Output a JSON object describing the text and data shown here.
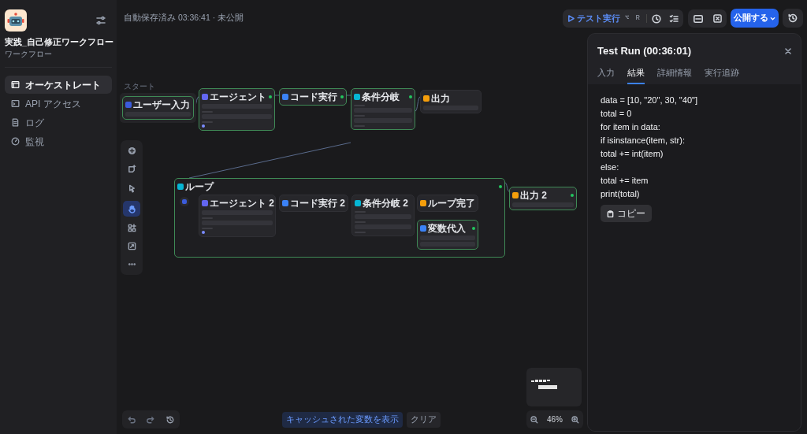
{
  "sidebar": {
    "app_title": "実践_自己修正ワークフロー",
    "app_type": "ワークフロー",
    "items": [
      {
        "kind": "orchestrate",
        "label": "オーケストレート",
        "selected": true
      },
      {
        "kind": "api",
        "label": "API アクセス",
        "selected": false
      },
      {
        "kind": "logs",
        "label": "ログ",
        "selected": false
      },
      {
        "kind": "monitor",
        "label": "監視",
        "selected": false
      }
    ]
  },
  "header": {
    "save_status": "自動保存済み 03:36:41 · 未公開",
    "test_run": "テスト実行",
    "shortcut_keys": [
      "⌥",
      "R"
    ],
    "publish": "公開する"
  },
  "canvas": {
    "start_group_label": "スタート",
    "nodes": [
      {
        "kind": "start",
        "title": "ユーザー入力",
        "succeeded": true
      },
      {
        "kind": "agent",
        "title": "エージェント",
        "succeeded": true
      },
      {
        "kind": "code",
        "title": "コード実行",
        "succeeded": true
      },
      {
        "kind": "ifelse",
        "title": "条件分岐",
        "succeeded": true
      },
      {
        "kind": "output",
        "title": "出力",
        "succeeded": false
      },
      {
        "kind": "loop",
        "title": "ループ",
        "succeeded": true,
        "children": [
          {
            "kind": "loop_start"
          },
          {
            "kind": "agent",
            "title": "エージェント 2",
            "succeeded": false
          },
          {
            "kind": "code",
            "title": "コード実行 2",
            "succeeded": false
          },
          {
            "kind": "ifelse",
            "title": "条件分岐 2",
            "succeeded": false
          },
          {
            "kind": "loop_end",
            "title": "ループ完了",
            "succeeded": false
          },
          {
            "kind": "assign",
            "title": "変数代入",
            "succeeded": true
          }
        ]
      },
      {
        "kind": "output",
        "title": "出力 2",
        "succeeded": true
      }
    ],
    "tools": [
      {
        "kind": "add"
      },
      {
        "kind": "note"
      },
      {
        "kind": "pointer",
        "selected": false
      },
      {
        "kind": "hand",
        "selected": true
      },
      {
        "kind": "organize"
      },
      {
        "kind": "maximize"
      },
      {
        "kind": "more"
      }
    ],
    "zoom": "46%",
    "show_cache": "キャッシュされた変数を表示",
    "clear": "クリア"
  },
  "panel": {
    "title": "Test Run (00:36:01)",
    "tabs": [
      {
        "label": "入力",
        "selected": false
      },
      {
        "label": "結果",
        "selected": true
      },
      {
        "label": "詳細情報",
        "selected": false
      },
      {
        "label": "実行追跡",
        "selected": false
      }
    ],
    "result_lines": [
      "data = [10, \"20\", 30, \"40\"]",
      "total = 0",
      "for item in data:",
      "if isinstance(item, str):",
      "total += int(item)",
      "else:",
      "total += item",
      "print(total)"
    ],
    "copy": "コピー"
  }
}
